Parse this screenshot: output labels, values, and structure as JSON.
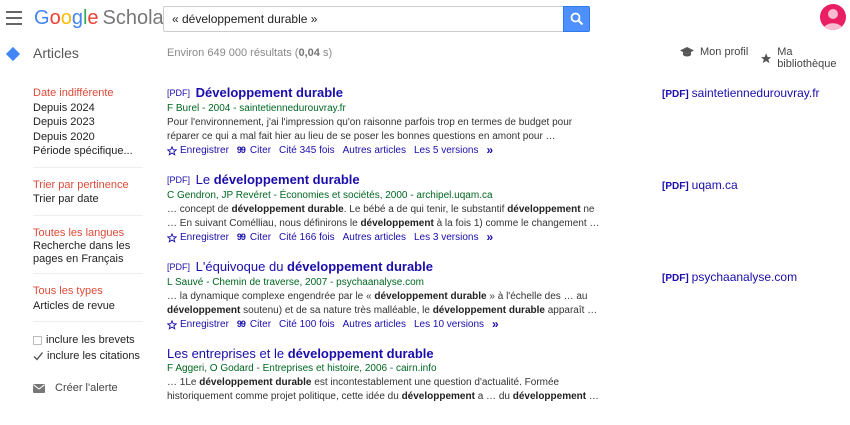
{
  "header": {
    "logo": {
      "g1": "G",
      "g2": "o",
      "g3": "o",
      "g4": "g",
      "g5": "l",
      "g6": "e",
      "scholar": "Scholar"
    },
    "search_value": "« développement durable »",
    "menu_icon": "hamburger-menu-icon",
    "search_icon": "magnifier-icon",
    "avatar_icon": "person-icon"
  },
  "subheader": {
    "title": "Articles",
    "results_prefix": "Environ 649 000 résultats (",
    "results_time": "0,04",
    "results_suffix": " s)",
    "profile_label": "Mon profil",
    "library_label": "Ma bibliothèque"
  },
  "sidebar": {
    "time_filters": [
      "Date indifférente",
      "Depuis 2024",
      "Depuis 2023",
      "Depuis 2020",
      "Période spécifique..."
    ],
    "sort_filters": [
      "Trier par pertinence",
      "Trier par date"
    ],
    "language_filters": [
      "Toutes les langues",
      "Recherche dans les pages en Français"
    ],
    "type_filters": [
      "Tous les types",
      "Articles de revue"
    ],
    "checkboxes": {
      "patents": "inclure les brevets",
      "citations": "inclure les citations"
    },
    "alert_label": "Créer l'alerte"
  },
  "results": [
    {
      "pdf_tag": "[PDF]",
      "title_pre": "",
      "title_bold": "Développement durable",
      "title_post": "",
      "authors": "F Burel - 2004 - saintetiennedurouvray.fr",
      "snippet1": "Pour l'environnement, j'ai l'impression qu'on raisonne parfois trop en termes de budget pour",
      "snippet2": "réparer ce qui a mal fait hier au lieu de se poser les bonnes questions en amont pour …",
      "save": "Enregistrer",
      "cite": "Citer",
      "cited_by": "Cité 345 fois",
      "related": "Autres articles",
      "versions": "Les 5 versions",
      "side_tag": "[PDF]",
      "side_domain": "saintetiennedurouvray.fr"
    },
    {
      "pdf_tag": "[PDF]",
      "title_pre": "Le ",
      "title_bold": "développement durable",
      "title_post": "",
      "authors": "C Gendron, JP Revéret - Économies et sociétés, 2000 - archipel.uqam.ca",
      "snippet1_a": "… concept de ",
      "snippet1_b": "développement durable",
      "snippet1_c": ". Le bébé a de qui tenir, le substantif ",
      "snippet1_d": "développement",
      "snippet1_e": " ne",
      "snippet2_a": "… En suivant Comélliau, nous définirons le ",
      "snippet2_b": "développement",
      "snippet2_c": " à la fois 1) comme le changement …",
      "save": "Enregistrer",
      "cite": "Citer",
      "cited_by": "Cité 166 fois",
      "related": "Autres articles",
      "versions": "Les 3 versions",
      "side_tag": "[PDF]",
      "side_domain": "uqam.ca"
    },
    {
      "pdf_tag": "[PDF]",
      "title_pre": "L'équivoque du ",
      "title_bold": "développement durable",
      "title_post": "",
      "authors": "L Sauvé - Chemin de traverse, 2007 - psychaanalyse.com",
      "snippet1_a": "… la dynamique complexe engendrée par le « ",
      "snippet1_b": "développement durable",
      "snippet1_c": " » à l'échelle des … au",
      "snippet2_a": "",
      "snippet2_b": "développement",
      "snippet2_c": " soutenu) et de sa nature très malléable, le ",
      "snippet2_d": "développement durable",
      "snippet2_e": " apparaît …",
      "save": "Enregistrer",
      "cite": "Citer",
      "cited_by": "Cité 100 fois",
      "related": "Autres articles",
      "versions": "Les 10 versions",
      "side_tag": "[PDF]",
      "side_domain": "psychaanalyse.com"
    },
    {
      "title_pre": "Les entreprises et le ",
      "title_bold": "développement durable",
      "authors": "F Aggeri, O Godard - Entreprises et histoire, 2006 - cairn.info",
      "snippet1_a": "… 1Le ",
      "snippet1_b": "développement durable",
      "snippet1_c": " est incontestablement une question d'actualité. Formée",
      "snippet2_a": "historiquement comme projet politique, cette idée du ",
      "snippet2_b": "développement",
      "snippet2_c": " a … du ",
      "snippet2_d": "développement",
      "snippet2_e": " …"
    }
  ]
}
